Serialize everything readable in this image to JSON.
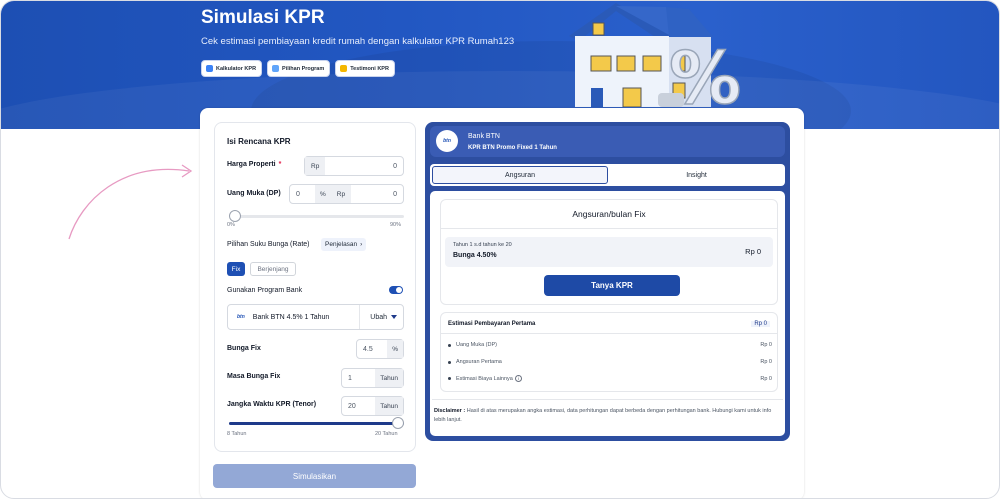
{
  "hero": {
    "title": "Simulasi KPR",
    "subtitle": "Cek estimasi pembiayaan kredit rumah dengan kalkulator KPR Rumah123",
    "chips": [
      {
        "label": "Kalkulator KPR",
        "icon": "calculator-icon",
        "color": "#3b82f6"
      },
      {
        "label": "Pilihan Program",
        "icon": "program-icon",
        "color": "#60a5fa"
      },
      {
        "label": "Testimoni KPR",
        "icon": "testimoni-icon",
        "color": "#f5b700"
      }
    ]
  },
  "form": {
    "title": "Isi Rencana KPR",
    "harga": {
      "label": "Harga Properti",
      "required": "*",
      "prefix": "Rp",
      "value": "0"
    },
    "dp": {
      "label": "Uang Muka (DP)",
      "percent_value": "0",
      "percent_suffix": "%",
      "prefix": "Rp",
      "value": "0",
      "min_label": "0%",
      "max_label": "90%",
      "level": 0
    },
    "suku": {
      "label": "Pilihan Suku Bunga (Rate)",
      "penjelasan": "Penjelasan",
      "fix": "Fix",
      "berjenjang": "Berjenjang"
    },
    "program": {
      "label": "Gunakan Program Bank",
      "toggle_on": true,
      "bank_logo": "btn",
      "bank_name": "Bank BTN 4.5% 1 Tahun",
      "ubah": "Ubah"
    },
    "bunga_fix": {
      "label": "Bunga Fix",
      "value": "4.5",
      "suffix": "%"
    },
    "masa": {
      "label": "Masa Bunga Fix",
      "value": "1",
      "suffix": "Tahun"
    },
    "tenor": {
      "label": "Jangka Waktu KPR (Tenor)",
      "value": "20",
      "suffix": "Tahun",
      "min_label": "8 Tahun",
      "max_label": "20 Tahun",
      "level": 1
    },
    "submit": "Simulasikan"
  },
  "result": {
    "bank_logo": "btn",
    "bank": "Bank BTN",
    "program": "KPR BTN Promo Fixed 1 Tahun",
    "tabs": [
      "Angsuran",
      "Insight"
    ],
    "angsuran_title": "Angsuran/bulan Fix",
    "period": "Tahun 1 s.d tahun ke 20",
    "bunga": "Bunga 4.50%",
    "amount": "Rp 0",
    "tanya": "Tanya KPR",
    "estimasi": {
      "title": "Estimasi Pembayaran Pertama",
      "total": "Rp 0",
      "rows": [
        {
          "label": "Uang Muka (DP)",
          "value": "Rp 0"
        },
        {
          "label": "Angsuran Pertama",
          "value": "Rp 0"
        },
        {
          "label": "Estimasi Biaya Lainnya",
          "value": "Rp 0"
        }
      ],
      "info_glyph": "i"
    },
    "disclaimer_label": "Disclaimer :",
    "disclaimer_text": "Hasil di atas merupakan angka estimasi, data perhitungan dapat berbeda dengan perhitungan bank. Hubungi kami untuk info lebih lanjut."
  }
}
